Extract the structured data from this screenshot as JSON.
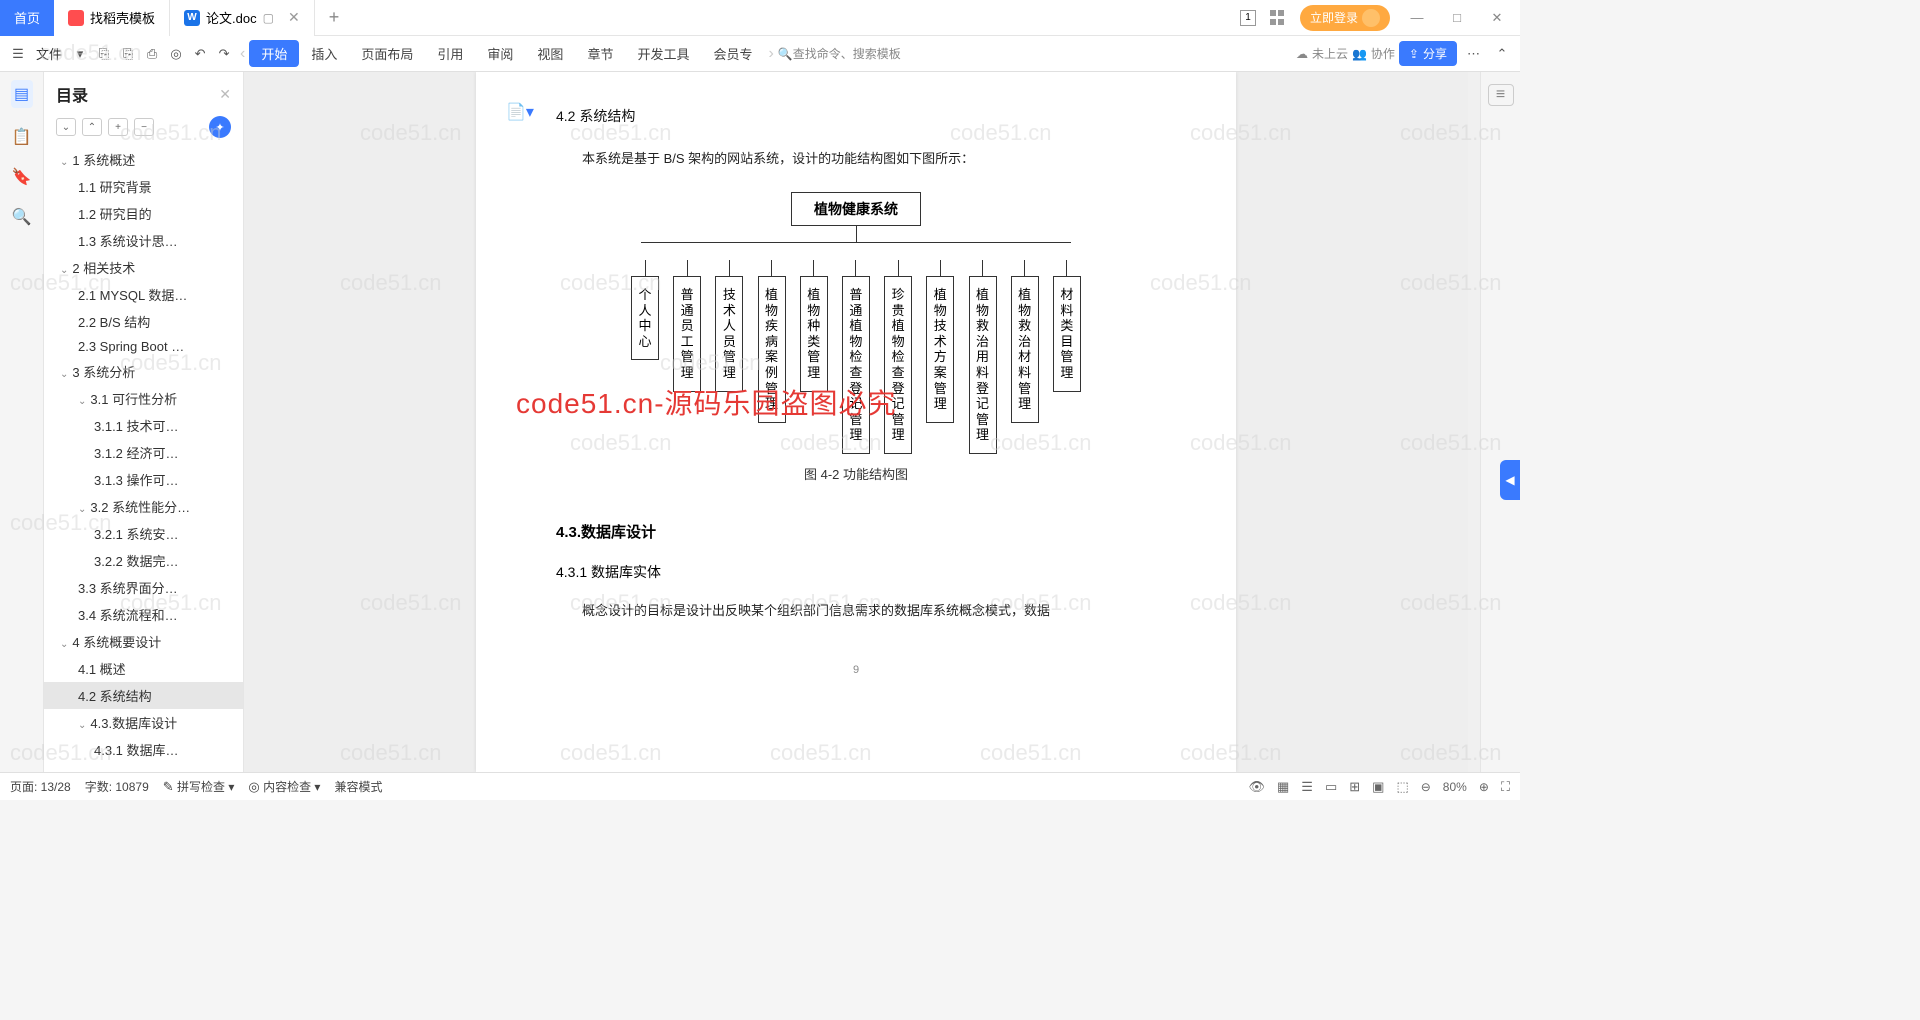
{
  "tabs": {
    "home": "首页",
    "template": "找稻壳模板",
    "doc": "论文.doc"
  },
  "titleRight": {
    "login": "立即登录"
  },
  "ribbon": {
    "file": "文件",
    "menus": [
      "开始",
      "插入",
      "页面布局",
      "引用",
      "审阅",
      "视图",
      "章节",
      "开发工具",
      "会员专"
    ],
    "search": "查找命令、搜索模板",
    "sync": "未上云",
    "collab": "协作",
    "share": "分享"
  },
  "outline": {
    "title": "目录",
    "items": [
      {
        "t": "1 系统概述",
        "lv": 1,
        "c": true
      },
      {
        "t": "1.1 研究背景",
        "lv": 2
      },
      {
        "t": "1.2 研究目的",
        "lv": 2
      },
      {
        "t": "1.3 系统设计思…",
        "lv": 2
      },
      {
        "t": "2 相关技术",
        "lv": 1,
        "c": true
      },
      {
        "t": "2.1 MYSQL 数据…",
        "lv": 2
      },
      {
        "t": "2.2 B/S 结构",
        "lv": 2
      },
      {
        "t": "2.3 Spring Boot …",
        "lv": 2
      },
      {
        "t": "3 系统分析",
        "lv": 1,
        "c": true
      },
      {
        "t": "3.1 可行性分析",
        "lv": 2,
        "c": true
      },
      {
        "t": "3.1.1 技术可…",
        "lv": 3
      },
      {
        "t": "3.1.2 经济可…",
        "lv": 3
      },
      {
        "t": "3.1.3 操作可…",
        "lv": 3
      },
      {
        "t": "3.2 系统性能分…",
        "lv": 2,
        "c": true
      },
      {
        "t": "3.2.1 系统安…",
        "lv": 3
      },
      {
        "t": "3.2.2 数据完…",
        "lv": 3
      },
      {
        "t": "3.3 系统界面分…",
        "lv": 2
      },
      {
        "t": "3.4 系统流程和…",
        "lv": 2
      },
      {
        "t": "4 系统概要设计",
        "lv": 1,
        "c": true
      },
      {
        "t": "4.1 概述",
        "lv": 2
      },
      {
        "t": "4.2 系统结构",
        "lv": 2,
        "sel": true
      },
      {
        "t": "4.3.数据库设计",
        "lv": 2,
        "c": true
      },
      {
        "t": "4.3.1 数据库…",
        "lv": 3
      }
    ]
  },
  "doc": {
    "h42": "4.2 系统结构",
    "intro": "本系统是基于 B/S 架构的网站系统，设计的功能结构图如下图所示：",
    "root": "植物健康系统",
    "cols": [
      "个人中心",
      "普通员工管理",
      "技术人员管理",
      "植物疾病案例管理",
      "植物种类管理",
      "普通植物检查登记管理",
      "珍贵植物检查登记管理",
      "植物技术方案管理",
      "植物救治用料登记管理",
      "植物救治材料管理",
      "材料类目管理"
    ],
    "caption": "图 4-2 功能结构图",
    "h43": "4.3.数据库设计",
    "h431": "4.3.1 数据库实体",
    "p2": "概念设计的目标是设计出反映某个组织部门信息需求的数据库系统概念模式，数据",
    "pagenum": "9"
  },
  "overlay": "code51.cn-源码乐园盗图必究",
  "watermark": "code51.cn",
  "status": {
    "page": "页面: 13/28",
    "words": "字数: 10879",
    "spell": "拼写检查",
    "content": "内容检查",
    "compat": "兼容模式",
    "zoom": "80%"
  },
  "chart_data": {
    "type": "tree",
    "title": "图 4-2 功能结构图",
    "root": "植物健康系统",
    "children": [
      "个人中心",
      "普通员工管理",
      "技术人员管理",
      "植物疾病案例管理",
      "植物种类管理",
      "普通植物检查登记管理",
      "珍贵植物检查登记管理",
      "植物技术方案管理",
      "植物救治用料登记管理",
      "植物救治材料管理",
      "材料类目管理"
    ]
  }
}
